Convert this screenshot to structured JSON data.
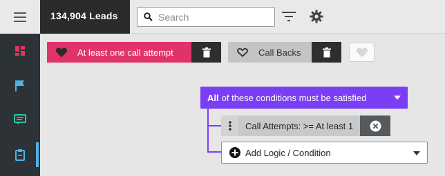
{
  "header": {
    "leads_count": "134,904 Leads",
    "search": {
      "placeholder": "Search",
      "value": ""
    }
  },
  "sidebar": {
    "items": [
      {
        "name": "dashboard",
        "icon": "dashboard-icon",
        "color": "#e2335f"
      },
      {
        "name": "campaigns",
        "icon": "flag-icon",
        "color": "#4fb3e8"
      },
      {
        "name": "messages",
        "icon": "message-icon",
        "color": "#2fc9a1"
      },
      {
        "name": "tasks",
        "icon": "clipboard-icon",
        "color": "#4fb3e8",
        "active": true
      }
    ]
  },
  "filters": {
    "chips": [
      {
        "label": "At least one call attempt",
        "icon": "heart-filled-icon",
        "color": "#e03369"
      },
      {
        "label": "Call Backs",
        "icon": "heart-outline-icon",
        "color": "#c4c4c4"
      }
    ]
  },
  "logic": {
    "group_all": "All",
    "group_rest": "of these conditions must be satisfied",
    "condition": "Call Attempts: >= At least 1",
    "add_label": "Add Logic / Condition"
  },
  "colors": {
    "accent_purple": "#7a3ff5",
    "rail_bg": "#2d3237",
    "active_indicator": "#4fb3e8"
  }
}
